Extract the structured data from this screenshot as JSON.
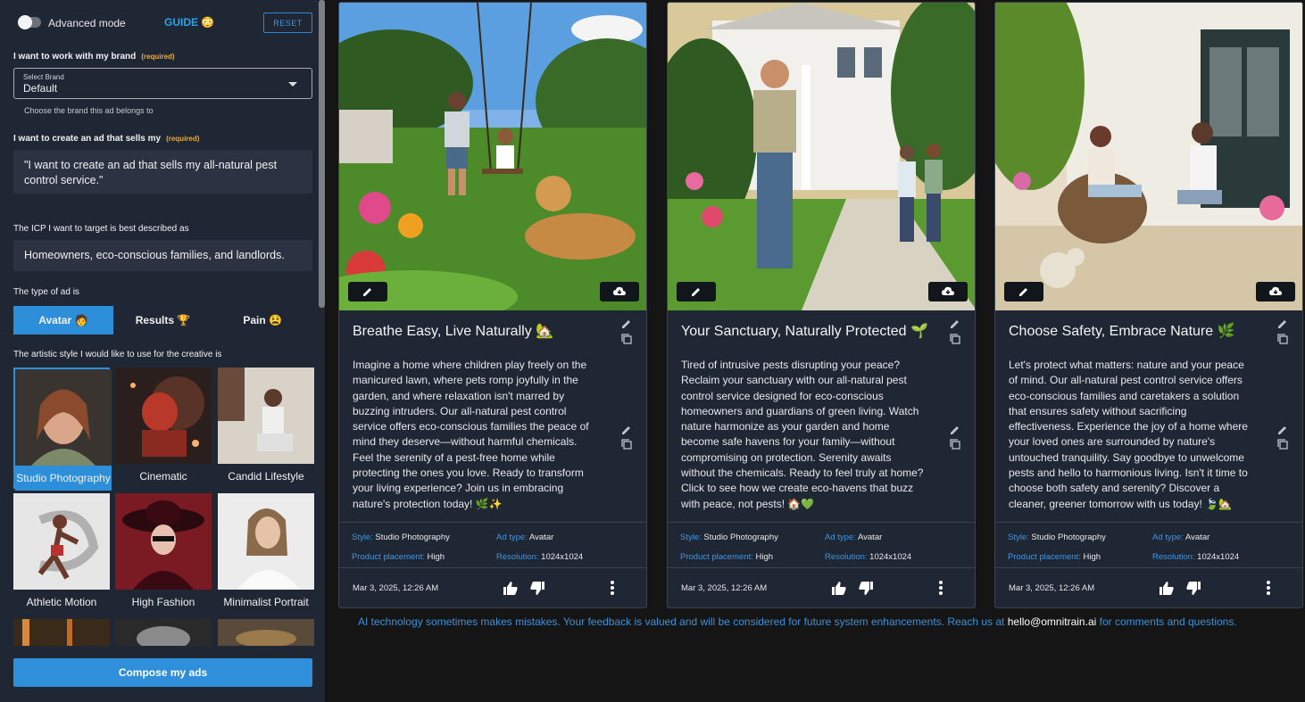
{
  "sidebar": {
    "advanced_mode": "Advanced mode",
    "guide": "GUIDE 😳",
    "reset": "RESET",
    "brand_label": "I want to work with my brand",
    "required": "(required)",
    "select_small": "Select Brand",
    "select_value": "Default",
    "brand_hint": "Choose the brand this ad belongs to",
    "sells_label": "I want to create an ad that sells my",
    "sells_value": "\"I want to create an ad that sells my all-natural pest control service.\"",
    "icp_label": "The ICP I want to target is best described as",
    "icp_value": "Homeowners, eco-conscious families, and landlords.",
    "adtype_label": "The type of ad is",
    "tabs": [
      "Avatar 🧑",
      "Results 🏆",
      "Pain 😫"
    ],
    "style_label": "The artistic style I would like to use for the creative is",
    "styles": [
      "Studio Photography",
      "Cinematic",
      "Candid Lifestyle",
      "Athletic Motion",
      "High Fashion",
      "Minimalist Portrait"
    ],
    "compose": "Compose my ads"
  },
  "cards": [
    {
      "title": "Breathe Easy, Live Naturally 🏡",
      "body": "Imagine a home where children play freely on the manicured lawn, where pets romp joyfully in the garden, and where relaxation isn't marred by buzzing intruders. Our all-natural pest control service offers eco-conscious families the peace of mind they deserve—without harmful chemicals. Feel the serenity of a pest-free home while protecting the ones you love. Ready to transform your living experience? Join us in embracing nature's protection today! 🌿✨",
      "style_k": "Style:",
      "style_v": "Studio Photography",
      "adtype_k": "Ad type:",
      "adtype_v": "Avatar",
      "placement_k": "Product placement:",
      "placement_v": "High",
      "res_k": "Resolution:",
      "res_v": "1024x1024",
      "date": "Mar 3, 2025, 12:26 AM"
    },
    {
      "title": "Your Sanctuary, Naturally Protected 🌱",
      "body": "Tired of intrusive pests disrupting your peace? Reclaim your sanctuary with our all-natural pest control service designed for eco-conscious homeowners and guardians of green living. Watch nature harmonize as your garden and home become safe havens for your family—without compromising on protection. Serenity awaits without the chemicals. Ready to feel truly at home? Click to see how we create eco-havens that buzz with peace, not pests! 🏠💚",
      "style_k": "Style:",
      "style_v": "Studio Photography",
      "adtype_k": "Ad type:",
      "adtype_v": "Avatar",
      "placement_k": "Product placement:",
      "placement_v": "High",
      "res_k": "Resolution:",
      "res_v": "1024x1024",
      "date": "Mar 3, 2025, 12:26 AM"
    },
    {
      "title": "Choose Safety, Embrace Nature 🌿",
      "body": "Let's protect what matters: nature and your peace of mind. Our all-natural pest control service offers eco-conscious families and caretakers a solution that ensures safety without sacrificing effectiveness. Experience the joy of a home where your loved ones are surrounded by nature's untouched tranquility. Say goodbye to unwelcome pests and hello to harmonious living. Isn't it time to choose both safety and serenity? Discover a cleaner, greener tomorrow with us today! 🍃🏡",
      "style_k": "Style:",
      "style_v": "Studio Photography",
      "adtype_k": "Ad type:",
      "adtype_v": "Avatar",
      "placement_k": "Product placement:",
      "placement_v": "High",
      "res_k": "Resolution:",
      "res_v": "1024x1024",
      "date": "Mar 3, 2025, 12:26 AM"
    }
  ],
  "footer": {
    "text": "AI technology sometimes makes mistakes. Your feedback is valued and will be considered for future system enhancements. Reach us at ",
    "email": "hello@omnitrain.ai",
    "tail": " for comments and questions."
  },
  "colors": {
    "accent": "#2d8fd9",
    "panel": "#1f2734",
    "required": "#f0a92a"
  }
}
